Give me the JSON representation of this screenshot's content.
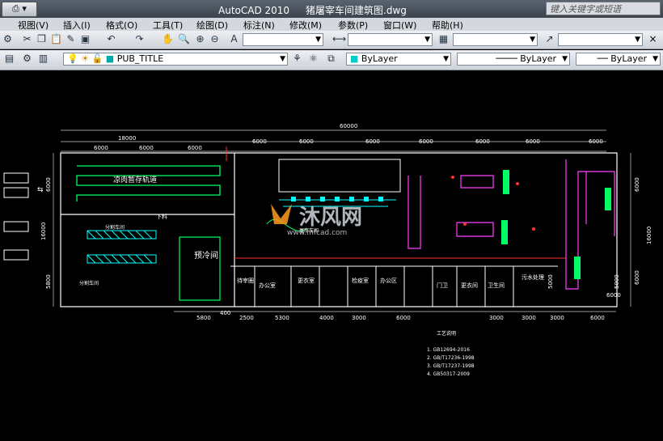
{
  "app": {
    "title": "AutoCAD 2010",
    "filename": "猪屠宰车间建筑图.dwg"
  },
  "search": {
    "placeholder": "键入关键字或短语"
  },
  "menu": [
    "视图(V)",
    "插入(I)",
    "格式(O)",
    "工具(T)",
    "绘图(D)",
    "标注(N)",
    "修改(M)",
    "参数(P)",
    "窗口(W)",
    "帮助(H)"
  ],
  "toolbar2": {
    "layer_name": "PUB_TITLE",
    "color": "ByLayer",
    "linetype": "ByLayer",
    "lineweight": "ByLayer"
  },
  "drawing": {
    "dims_top": [
      "60000",
      "18000",
      "6000",
      "6000",
      "6000",
      "6000",
      "6000",
      "6000",
      "6000",
      "6000",
      "6000",
      "6000",
      "6000"
    ],
    "dims_bottom": [
      "5800",
      "400",
      "2500",
      "5300",
      "4000",
      "3000",
      "6000",
      "3000",
      "3000",
      "3000",
      "6000"
    ],
    "dims_left": [
      "6000",
      "16000",
      "5800"
    ],
    "dims_right": [
      "6000",
      "16000",
      "6000",
      "5000",
      "5000",
      "6000"
    ],
    "rooms": [
      "凉肉暂存轨道",
      "分割车间",
      "分割车间",
      "预冷间",
      "下料",
      "屠宰车间",
      "待宰圈",
      "办公室",
      "更衣室",
      "门卫",
      "卫生间",
      "检疫室",
      "办公区",
      "更衣间",
      "污水处理"
    ],
    "watermark": "沐风网",
    "watermark_url": "www.mfcad.com",
    "notes_title": "工艺说明",
    "notes": [
      "1. GB12694-2016",
      "2. GB/T17236-1998",
      "3. GB/T17237-1998",
      "4. GB50317-2009"
    ]
  },
  "colors": {
    "titlebar": "#3b434d",
    "canvas": "#000000",
    "wall": "#ffffff",
    "accent_red": "#ff3030",
    "cyan": "#00ffff",
    "green": "#00ff66",
    "magenta": "#ff40ff"
  }
}
